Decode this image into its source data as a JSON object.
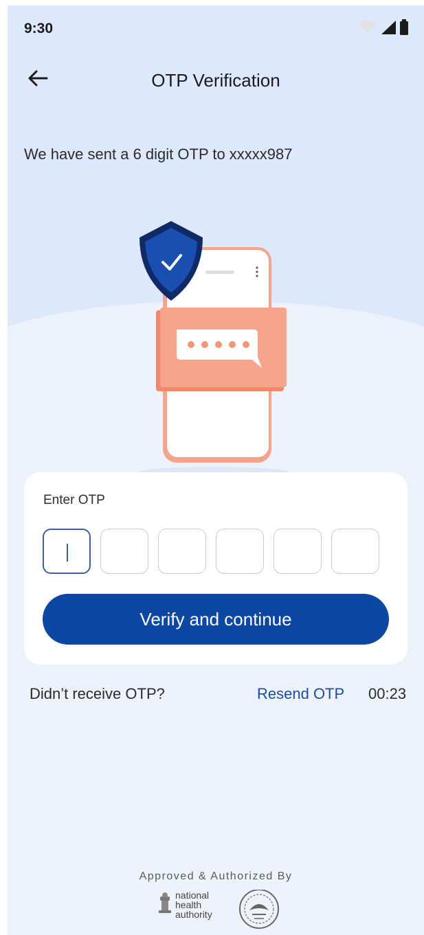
{
  "status_bar": {
    "time": "9:30",
    "icons": [
      "wifi-icon",
      "signal-icon",
      "battery-icon"
    ]
  },
  "app_bar": {
    "title": "OTP Verification",
    "back_icon": "arrow-left-icon"
  },
  "message": "We have sent a 6 digit OTP to xxxxx987",
  "otp_card": {
    "label": "Enter OTP",
    "digits": [
      "",
      "",
      "",
      "",
      "",
      ""
    ],
    "active_index": 0,
    "button_label": "Verify and continue"
  },
  "resend": {
    "prompt": "Didn’t receive OTP?",
    "link": "Resend OTP",
    "timer": "00:23"
  },
  "footer": {
    "approved": "Approved & Authorized By",
    "logo_text": [
      "national",
      "health",
      "authority"
    ]
  },
  "colors": {
    "primary": "#0c47a1",
    "link": "#1c4ba3",
    "background_top": "#dde8fb",
    "background": "#eef2fb",
    "illustration_accent": "#f7a48c",
    "shield": "#1a4fb0"
  }
}
